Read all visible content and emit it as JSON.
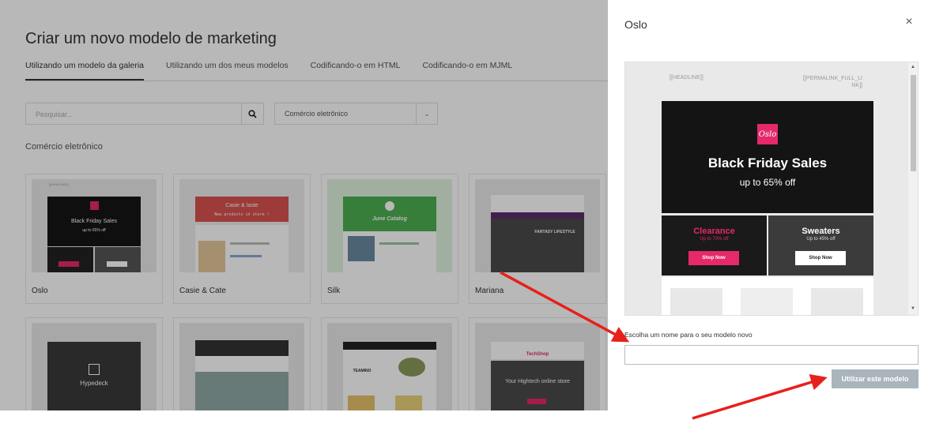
{
  "page": {
    "title": "Criar um novo modelo de marketing",
    "tabs": [
      {
        "label": "Utilizando um modelo da galeria"
      },
      {
        "label": "Utilizando um dos meus modelos"
      },
      {
        "label": "Codificando-o em HTML"
      },
      {
        "label": "Codificando-o em MJML"
      }
    ],
    "search_placeholder": "Pesquisar...",
    "category_select": "Comércio eletrônico",
    "section_label": "Comércio eletrônico",
    "templates": [
      {
        "name": "Oslo"
      },
      {
        "name": "Casie & Cate"
      },
      {
        "name": "Silk"
      },
      {
        "name": "Mariana"
      },
      {
        "name": ""
      },
      {
        "name": ""
      },
      {
        "name": ""
      },
      {
        "name": ""
      }
    ],
    "thumb_texts": {
      "headline": "[[HEADLINE]]",
      "oslo_title": "Black Friday Sales",
      "oslo_sub": "up to 65% off",
      "casie_brand": "Casie & Iaste",
      "casie_line": "New products in store !",
      "silk_title": "June Catalog",
      "mariana_line": "FANTASY LIFESTYLE",
      "hypedeck": "Hypedeck",
      "techshop": "TechShop",
      "techshop_line": "Your Hightech online store",
      "teamino": "TEAMINO"
    }
  },
  "panel": {
    "title": "Oslo",
    "close_icon": "×",
    "preview": {
      "headline": "[[HEADLINE]]",
      "permalink": "[[PERMALINK_FULL_LI NK]]",
      "logo": "Oslo",
      "hero_title": "Black Friday Sales",
      "hero_sub": "up to 65% off",
      "left_title": "Clearance",
      "left_sub": "Up to 70% off",
      "left_btn": "Shop Now",
      "right_title": "Sweaters",
      "right_sub": "Up to 45% off",
      "right_btn": "Shop Now",
      "accent": "#e5296b"
    },
    "name_label": "Escolha um nome para o seu modelo novo",
    "name_value": "",
    "use_button": "Utilizar este modelo"
  }
}
